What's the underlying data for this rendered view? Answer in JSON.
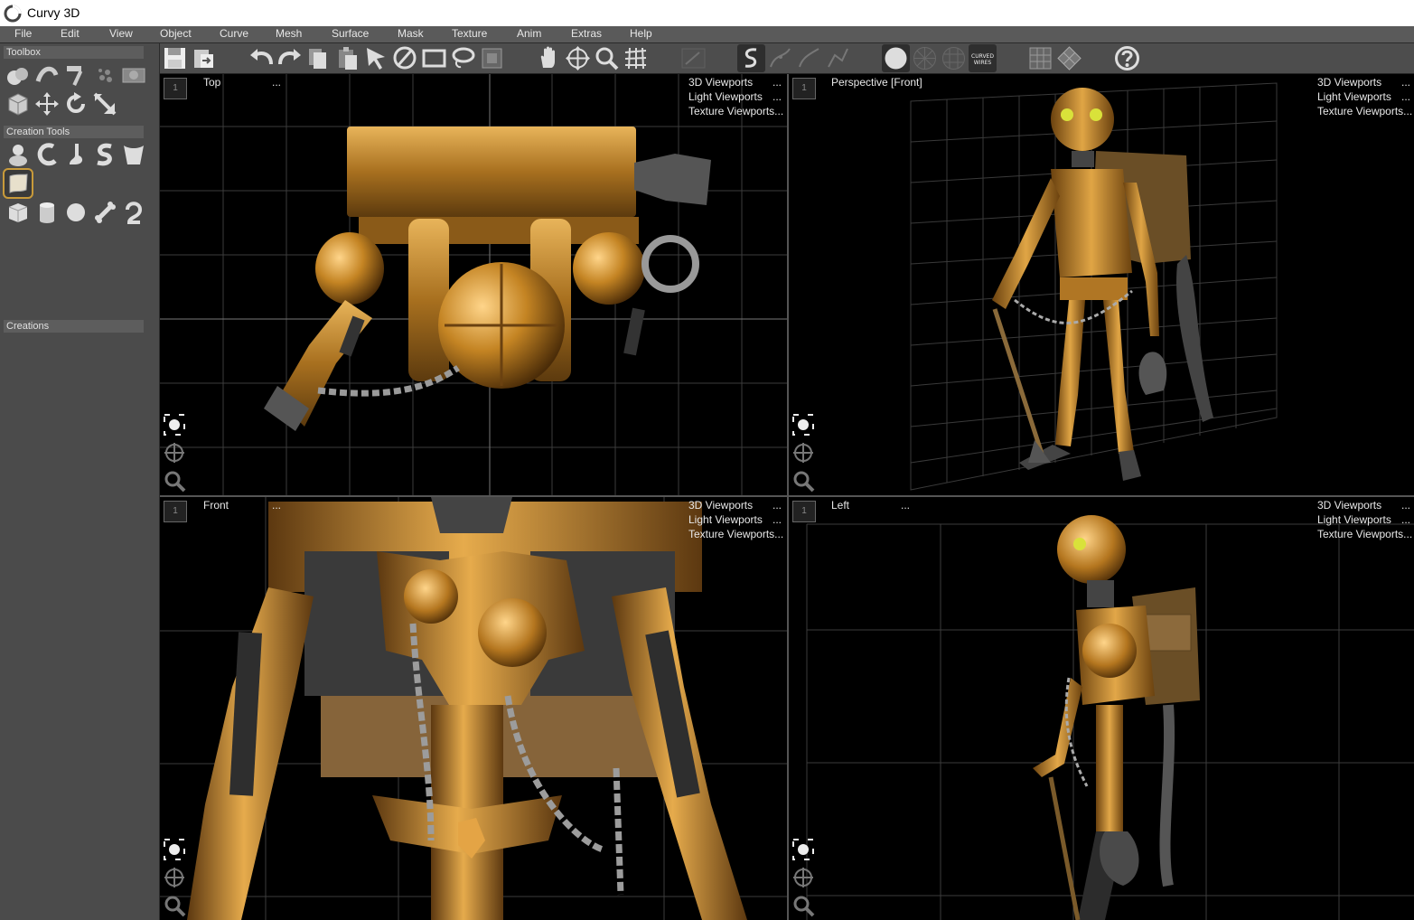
{
  "app": {
    "title": "Curvy 3D"
  },
  "menu": [
    "File",
    "Edit",
    "View",
    "Object",
    "Curve",
    "Mesh",
    "Surface",
    "Mask",
    "Texture",
    "Anim",
    "Extras",
    "Help"
  ],
  "left_panel": {
    "toolbox_label": "Toolbox",
    "creation_tools_label": "Creation Tools",
    "creations_label": "Creations"
  },
  "toolbar": {
    "curved_wires_label": "CURVED WIRES"
  },
  "viewports": {
    "links": [
      "3D Viewports",
      "Light Viewports",
      "Texture Viewports..."
    ],
    "ellipsis": "...",
    "number": "1",
    "top": {
      "name": "Top",
      "dots": "..."
    },
    "perspective": {
      "name": "Perspective [Front]"
    },
    "front": {
      "name": "Front",
      "dots": "..."
    },
    "left": {
      "name": "Left",
      "dots": "..."
    }
  },
  "colors": {
    "accent_gold": "#c98a2a",
    "viewport_bg": "#000000",
    "panel": "#4b4b4b"
  }
}
